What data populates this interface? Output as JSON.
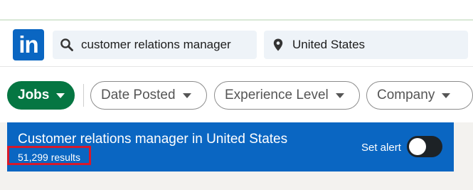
{
  "header": {
    "logo_text": "in",
    "keyword_search": {
      "icon": "search-icon",
      "value": "customer relations manager"
    },
    "location_search": {
      "icon": "location-pin-icon",
      "value": "United States"
    }
  },
  "filters": {
    "jobs_label": "Jobs",
    "date_posted_label": "Date Posted",
    "experience_level_label": "Experience Level",
    "company_label": "Company"
  },
  "results_banner": {
    "title": "Customer relations manager in United States",
    "count": "51,299 results",
    "set_alert_label": "Set alert",
    "alert_enabled": false
  },
  "colors": {
    "brand_blue": "#0a66c2",
    "jobs_green": "#057642",
    "highlight_red": "#d6192b"
  }
}
